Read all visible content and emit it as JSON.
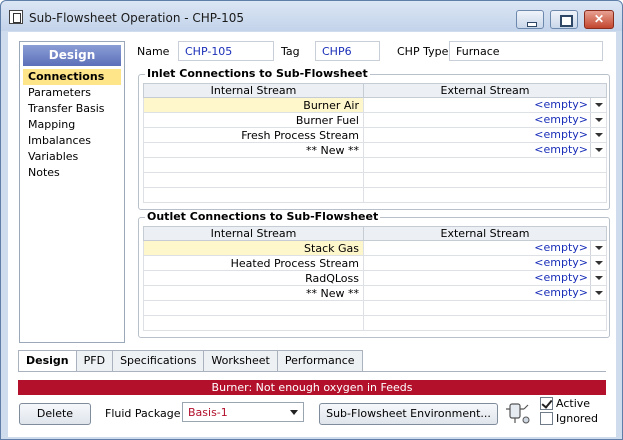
{
  "window": {
    "title": "Sub-Flowsheet Operation - CHP-105"
  },
  "sidebar": {
    "header": "Design",
    "items": [
      {
        "label": "Connections",
        "active": true
      },
      {
        "label": "Parameters"
      },
      {
        "label": "Transfer Basis"
      },
      {
        "label": "Mapping"
      },
      {
        "label": "Imbalances"
      },
      {
        "label": "Variables"
      },
      {
        "label": "Notes"
      }
    ]
  },
  "header_fields": {
    "name_label": "Name",
    "name_value": "CHP-105",
    "tag_label": "Tag",
    "tag_value": "CHP6",
    "chp_type_label": "CHP Type",
    "chp_type_value": "Furnace"
  },
  "inlet": {
    "title": "Inlet Connections to Sub-Flowsheet",
    "col_internal": "Internal Stream",
    "col_external": "External Stream",
    "rows": [
      {
        "internal": "Burner Air",
        "external": "<empty>"
      },
      {
        "internal": "Burner Fuel",
        "external": "<empty>"
      },
      {
        "internal": "Fresh Process Stream",
        "external": "<empty>"
      },
      {
        "internal": "** New **",
        "external": "<empty>"
      }
    ]
  },
  "outlet": {
    "title": "Outlet Connections to Sub-Flowsheet",
    "col_internal": "Internal Stream",
    "col_external": "External Stream",
    "rows": [
      {
        "internal": "Stack Gas",
        "external": "<empty>"
      },
      {
        "internal": "Heated Process Stream",
        "external": "<empty>"
      },
      {
        "internal": "RadQLoss",
        "external": "<empty>"
      },
      {
        "internal": "** New **",
        "external": "<empty>"
      }
    ]
  },
  "tabs": [
    "Design",
    "PFD",
    "Specifications",
    "Worksheet",
    "Performance"
  ],
  "status_message": "Burner: Not enough oxygen in Feeds",
  "footer": {
    "delete_label": "Delete",
    "fluid_package_label": "Fluid Package",
    "fluid_package_value": "Basis-1",
    "env_button_label": "Sub-Flowsheet Environment...",
    "active_label": "Active",
    "active_checked": true,
    "ignored_label": "Ignored",
    "ignored_checked": false
  },
  "colors": {
    "status_bar": "#b3102c",
    "accent_link": "#1a2fb8",
    "highlight_row": "#fff7cc"
  }
}
